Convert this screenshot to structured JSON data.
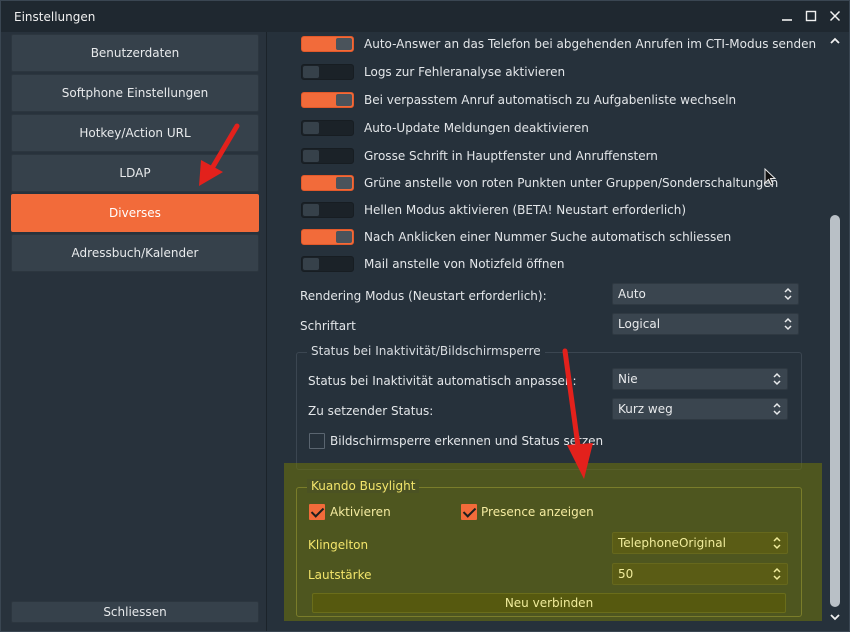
{
  "window": {
    "title": "Einstellungen"
  },
  "sidebar": {
    "items": [
      {
        "label": "Benutzerdaten",
        "active": false
      },
      {
        "label": "Softphone Einstellungen",
        "active": false
      },
      {
        "label": "Hotkey/Action URL",
        "active": false
      },
      {
        "label": "LDAP",
        "active": false
      },
      {
        "label": "Diverses",
        "active": true
      },
      {
        "label": "Adressbuch/Kalender",
        "active": false
      }
    ],
    "close_label": "Schliessen"
  },
  "toggles": [
    {
      "label": "Auto-Answer an das Telefon bei abgehenden Anrufen im CTI-Modus senden",
      "on": true
    },
    {
      "label": "Logs zur Fehleranalyse aktivieren",
      "on": false
    },
    {
      "label": "Bei verpasstem Anruf automatisch zu Aufgabenliste wechseln",
      "on": true
    },
    {
      "label": "Auto-Update Meldungen deaktivieren",
      "on": false
    },
    {
      "label": "Grosse Schrift in Hauptfenster und Anruffenstern",
      "on": false
    },
    {
      "label": "Grüne anstelle von roten Punkten unter Gruppen/Sonderschaltungen",
      "on": true
    },
    {
      "label": "Hellen Modus aktivieren (BETA! Neustart erforderlich)",
      "on": false
    },
    {
      "label": "Nach Anklicken einer Nummer Suche automatisch schliessen",
      "on": true
    },
    {
      "label": "Mail anstelle von Notizfeld öffnen",
      "on": false
    }
  ],
  "rendering": {
    "label": "Rendering Modus (Neustart erforderlich):",
    "value": "Auto"
  },
  "font": {
    "label": "Schriftart",
    "value": "Logical"
  },
  "inactivity": {
    "title": "Status bei Inaktivität/Bildschirmsperre",
    "auto_label": "Status bei Inaktivität automatisch anpassen:",
    "auto_value": "Nie",
    "status_label": "Zu setzender Status:",
    "status_value": "Kurz weg",
    "lock_label": "Bildschirmsperre erkennen und Status setzen",
    "lock_checked": false
  },
  "busylight": {
    "title": "Kuando Busylight",
    "activate_label": "Aktivieren",
    "activate_checked": true,
    "presence_label": "Presence anzeigen",
    "presence_checked": true,
    "ringtone_label": "Klingelton",
    "ringtone_value": "TelephoneOriginal",
    "volume_label": "Lautstärke",
    "volume_value": "50",
    "connect_label": "Neu verbinden"
  },
  "colors": {
    "accent": "#f26b3a",
    "highlight": "#70750a",
    "annotation_arrow": "#e3211c"
  }
}
